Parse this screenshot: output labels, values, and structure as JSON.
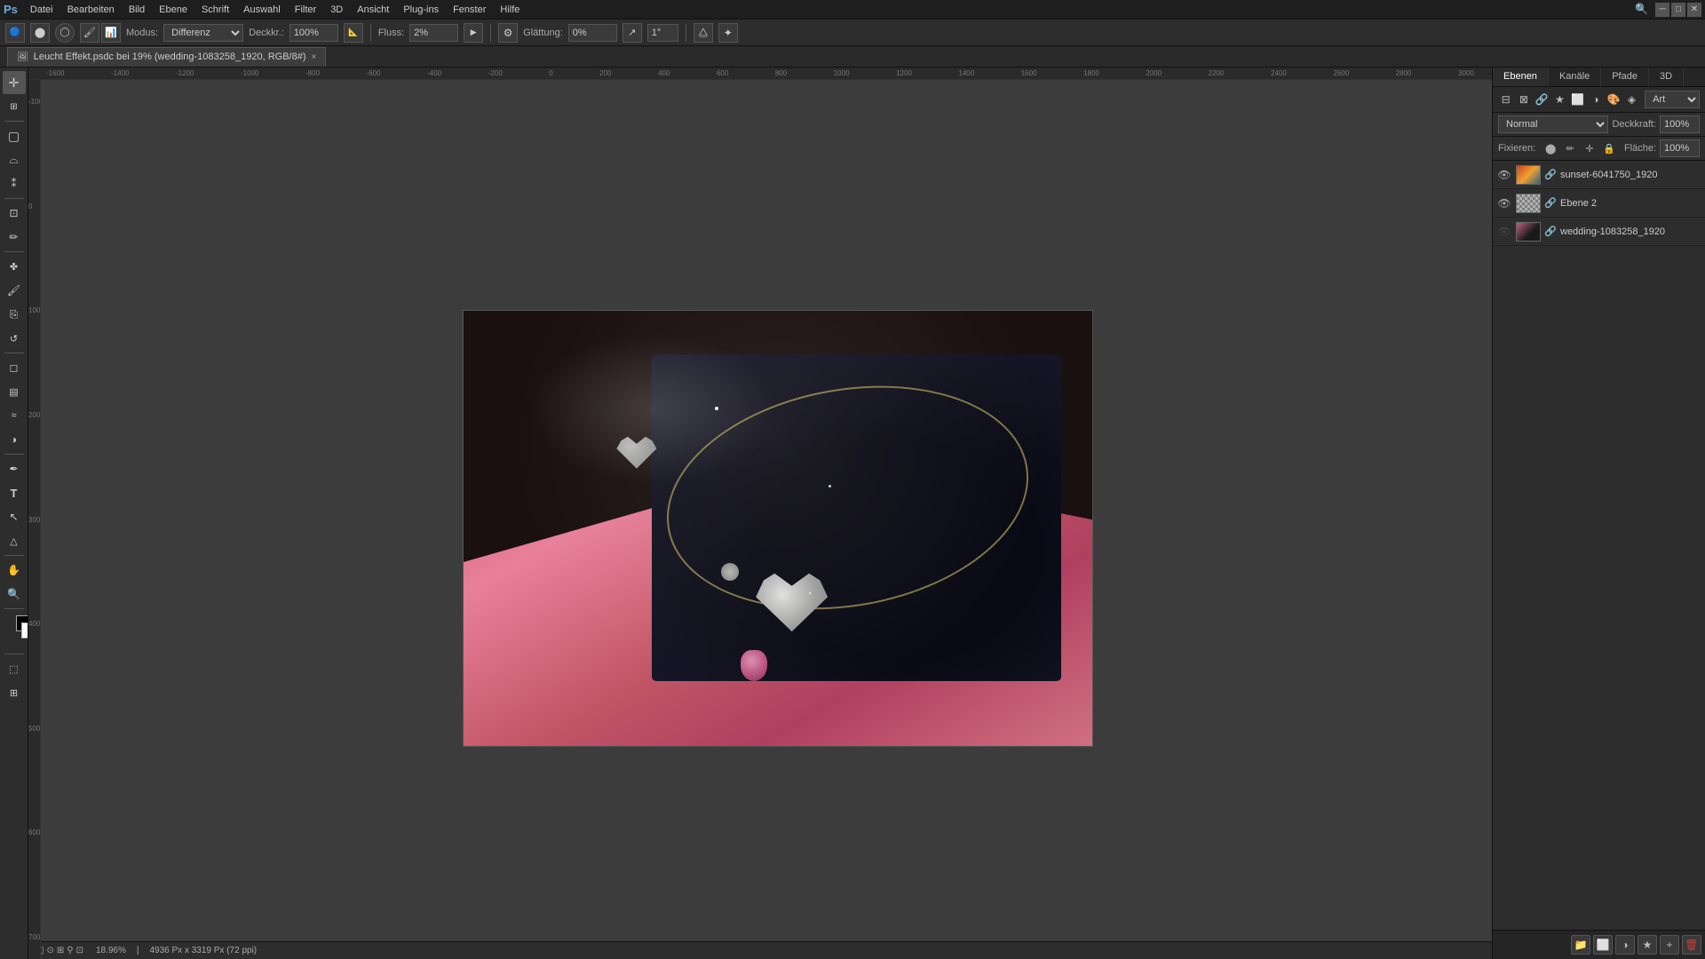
{
  "window": {
    "title": "Photoshop",
    "controls": [
      "minimize",
      "maximize",
      "close"
    ]
  },
  "menu": {
    "items": [
      "Datei",
      "Bearbeiten",
      "Bild",
      "Ebene",
      "Schrift",
      "Auswahl",
      "Filter",
      "3D",
      "Ansicht",
      "Plug-ins",
      "Fenster",
      "Hilfe"
    ]
  },
  "options_bar": {
    "mode_label": "Modus:",
    "mode_value": "Differenz",
    "deckkraft_label": "Deckkr.:",
    "deckkraft_value": "100%",
    "fluss_label": "Fluss:",
    "fluss_value": "2%",
    "glaettung_label": "Glättung:",
    "glaettung_value": "0%",
    "angle_value": "1°"
  },
  "tab": {
    "filename": "Leucht Effekt.psdc bei 19% (wedding-1083258_1920, RGB/8#)",
    "close_label": "×"
  },
  "canvas": {
    "zoom": "18.96%",
    "dimensions": "4936 Px x 3319 Px (72 ppi)"
  },
  "right_panel": {
    "tabs": [
      "Ebenen",
      "Kanäle",
      "Pfade",
      "3D"
    ],
    "active_tab": "Ebenen",
    "blend_mode": "Normal",
    "opacity_label": "Deckkraft:",
    "opacity_value": "100%",
    "fill_label": "Fläche:",
    "fill_value": "100%",
    "lock_label": "Fixieren:",
    "search_placeholder": "Art",
    "layers": [
      {
        "name": "sunset-6041750_1920",
        "type": "sunset",
        "visible": true
      },
      {
        "name": "Ebene 2",
        "type": "ebene",
        "visible": true
      },
      {
        "name": "wedding-1083258_1920",
        "type": "wedding",
        "visible": false
      }
    ]
  },
  "tools": {
    "items": [
      "move",
      "select-rect",
      "lasso",
      "magic-wand",
      "crop",
      "eyedropper",
      "spot-heal",
      "brush",
      "clone-stamp",
      "history-brush",
      "eraser",
      "gradient",
      "blur",
      "dodge",
      "pen",
      "text",
      "path-select",
      "shape",
      "hand",
      "zoom"
    ],
    "active": "brush"
  },
  "status": {
    "zoom": "18.96%",
    "dimensions": "4936 Px x 3319 Px (72 ppi)"
  }
}
